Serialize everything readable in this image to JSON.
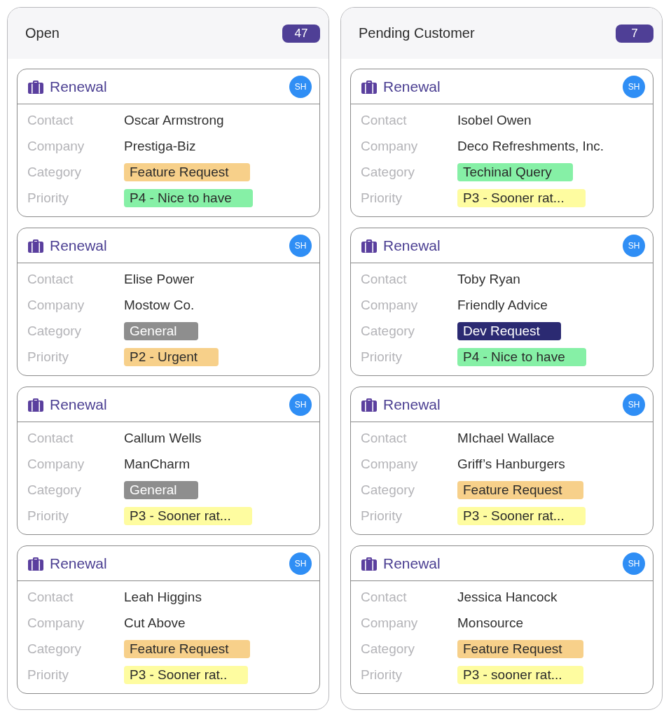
{
  "columns": [
    {
      "title": "Open",
      "count": "47",
      "cards": [
        {
          "title": "Renewal",
          "avatar": "SH",
          "fields": [
            {
              "label": "Contact",
              "value": "Oscar Armstrong",
              "kind": "text"
            },
            {
              "label": "Company",
              "value": "Prestiga-Biz",
              "kind": "text"
            },
            {
              "label": "Category",
              "value": "Feature Request",
              "kind": "tag",
              "color": "#f7d08a"
            },
            {
              "label": "Priority",
              "value": "P4 - Nice to have",
              "kind": "tag",
              "color": "#86f0a6"
            }
          ]
        },
        {
          "title": "Renewal",
          "avatar": "SH",
          "fields": [
            {
              "label": "Contact",
              "value": "Elise Power",
              "kind": "text"
            },
            {
              "label": "Company",
              "value": "Mostow Co.",
              "kind": "text"
            },
            {
              "label": "Category",
              "value": "General",
              "kind": "tag",
              "color": "#8e8e8e"
            },
            {
              "label": "Priority",
              "value": "P2 - Urgent",
              "kind": "tag",
              "color": "#f7d08a"
            }
          ]
        },
        {
          "title": "Renewal",
          "avatar": "SH",
          "fields": [
            {
              "label": "Contact",
              "value": "Callum Wells",
              "kind": "text"
            },
            {
              "label": "Company",
              "value": "ManCharm",
              "kind": "text"
            },
            {
              "label": "Category",
              "value": "General",
              "kind": "tag",
              "color": "#8e8e8e"
            },
            {
              "label": "Priority",
              "value": "P3 - Sooner rat...",
              "kind": "tag",
              "color": "#fefca0"
            }
          ]
        },
        {
          "title": "Renewal",
          "avatar": "SH",
          "fields": [
            {
              "label": "Contact",
              "value": "Leah Higgins",
              "kind": "text"
            },
            {
              "label": "Company",
              "value": "Cut Above",
              "kind": "text"
            },
            {
              "label": "Category",
              "value": "Feature Request",
              "kind": "tag",
              "color": "#f7d08a"
            },
            {
              "label": "Priority",
              "value": "P3 - Sooner rat..",
              "kind": "tag",
              "color": "#fefca0"
            }
          ]
        }
      ]
    },
    {
      "title": "Pending Customer",
      "count": "7",
      "cards": [
        {
          "title": "Renewal",
          "avatar": "SH",
          "fields": [
            {
              "label": "Contact",
              "value": "Isobel Owen",
              "kind": "text"
            },
            {
              "label": "Company",
              "value": "Deco Refreshments, Inc.",
              "kind": "text"
            },
            {
              "label": "Category",
              "value": "Techinal Query",
              "kind": "tag",
              "color": "#86f0a6"
            },
            {
              "label": "Priority",
              "value": "P3 - Sooner rat...",
              "kind": "tag",
              "color": "#fefca0"
            }
          ]
        },
        {
          "title": "Renewal",
          "avatar": "SH",
          "fields": [
            {
              "label": "Contact",
              "value": "Toby Ryan",
              "kind": "text"
            },
            {
              "label": "Company",
              "value": "Friendly Advice",
              "kind": "text"
            },
            {
              "label": "Category",
              "value": "Dev Request",
              "kind": "tag",
              "color": "#2b2a72"
            },
            {
              "label": "Priority",
              "value": "P4 - Nice to have",
              "kind": "tag",
              "color": "#86f0a6"
            }
          ]
        },
        {
          "title": "Renewal",
          "avatar": "SH",
          "fields": [
            {
              "label": "Contact",
              "value": "MIchael Wallace",
              "kind": "text"
            },
            {
              "label": "Company",
              "value": "Griff’s Hanburgers",
              "kind": "text"
            },
            {
              "label": "Category",
              "value": "Feature Request",
              "kind": "tag",
              "color": "#f7d08a"
            },
            {
              "label": "Priority",
              "value": "P3 - Sooner rat...",
              "kind": "tag",
              "color": "#fefca0"
            }
          ]
        },
        {
          "title": "Renewal",
          "avatar": "SH",
          "fields": [
            {
              "label": "Contact",
              "value": "Jessica Hancock",
              "kind": "text"
            },
            {
              "label": "Company",
              "value": "Monsource",
              "kind": "text"
            },
            {
              "label": "Category",
              "value": "Feature Request",
              "kind": "tag",
              "color": "#f7d08a"
            },
            {
              "label": "Priority",
              "value": "P3 - sooner rat...",
              "kind": "tag",
              "color": "#fefca0"
            }
          ]
        }
      ]
    }
  ]
}
